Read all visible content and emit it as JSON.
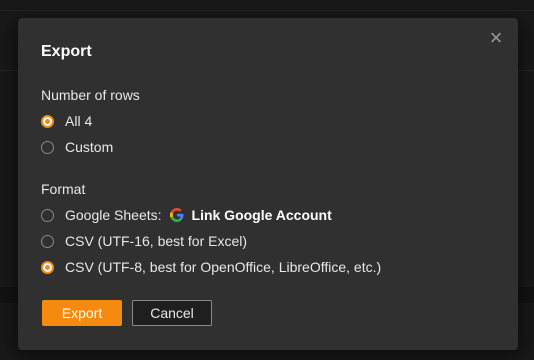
{
  "dialog": {
    "title": "Export",
    "close_icon": "close-icon",
    "rows_section": {
      "label": "Number of rows",
      "options": [
        {
          "label": "All 4",
          "selected": true
        },
        {
          "label": "Custom",
          "selected": false
        }
      ]
    },
    "format_section": {
      "label": "Format",
      "options": [
        {
          "label": "Google Sheets:",
          "selected": false,
          "link_label": "Link Google Account",
          "icon": "google-icon"
        },
        {
          "label": "CSV (UTF-16, best for Excel)",
          "selected": false
        },
        {
          "label": "CSV (UTF-8, best for OpenOffice, LibreOffice, etc.)",
          "selected": true
        }
      ]
    },
    "buttons": {
      "export_label": "Export",
      "cancel_label": "Cancel"
    }
  },
  "colors": {
    "accent": "#f68a0e",
    "dialog_bg": "#303030",
    "text": "#e8e8e8"
  }
}
